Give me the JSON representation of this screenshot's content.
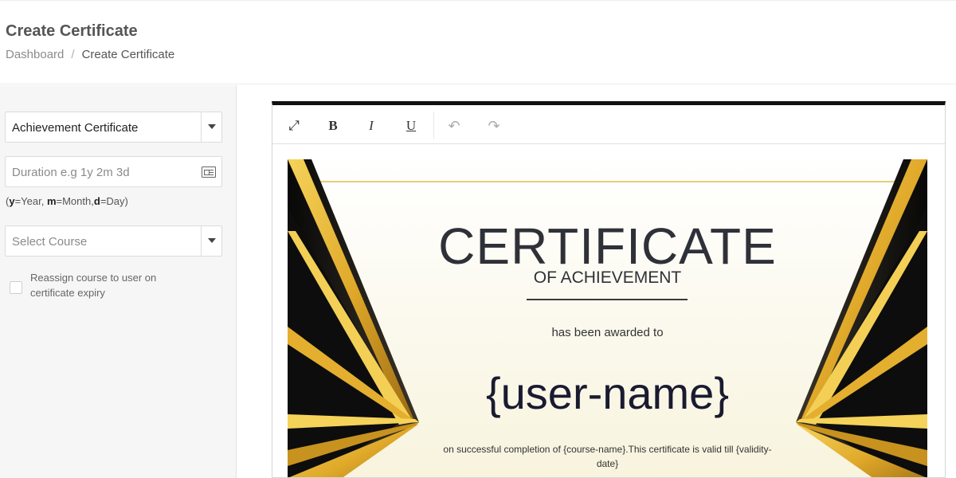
{
  "header": {
    "title": "Create Certificate",
    "breadcrumb": {
      "home": "Dashboard",
      "separator": "/",
      "current": "Create Certificate"
    }
  },
  "form": {
    "template_select": {
      "value": "Achievement Certificate",
      "icon": "chevron-down-icon"
    },
    "duration": {
      "placeholder": "Duration e.g 1y 2m 3d",
      "icon": "calendar-icon"
    },
    "hint": {
      "y_key": "y",
      "y_text": "=Year, ",
      "m_key": "m",
      "m_text": "=Month,",
      "d_key": "d",
      "d_text": "=Day)",
      "open": "("
    },
    "course_select": {
      "placeholder": "Select Course",
      "icon": "chevron-down-icon"
    },
    "reassign_checkbox": {
      "label": "Reassign course to user on certificate expiry",
      "checked": false
    }
  },
  "editor": {
    "toolbar": {
      "fullscreen": "⤢",
      "bold": "B",
      "italic": "I",
      "underline": "U",
      "undo": "↶",
      "redo": "↷"
    },
    "certificate": {
      "title": "CERTIFICATE",
      "subtitle": "OF ACHIEVEMENT",
      "awarded": "has been awarded to",
      "name": "{user-name}",
      "description": "on successful completion of {course-name}.This certificate is valid till {validity-date}"
    }
  },
  "colors": {
    "gold": "#e8b92e",
    "gold_dark": "#b07c1a",
    "black": "#141414",
    "cream": "#fdfbee"
  }
}
